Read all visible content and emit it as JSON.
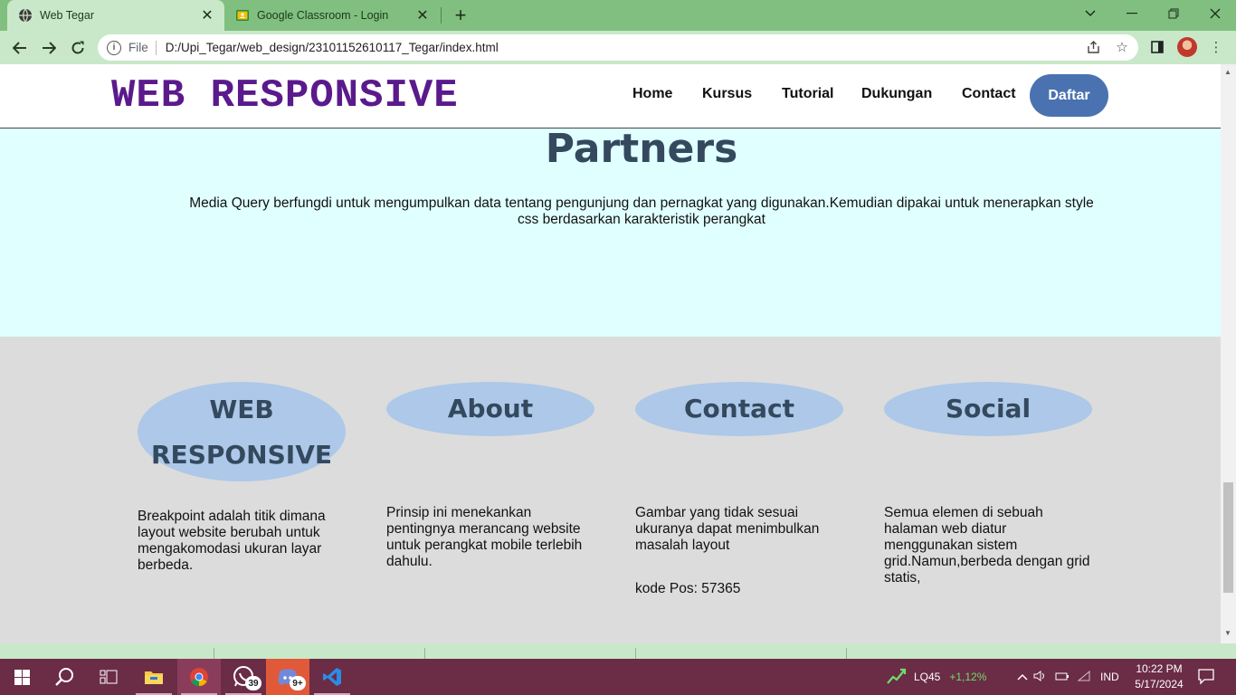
{
  "browser": {
    "tabs": [
      {
        "title": "Web Tegar",
        "active": true
      },
      {
        "title": "Google Classroom - Login",
        "active": false
      }
    ],
    "address": {
      "scheme_label": "File",
      "url": "D:/Upi_Tegar/web_design/23101152610117_Tegar/index.html"
    }
  },
  "site": {
    "logo": "WEB RESPONSIVE",
    "nav": [
      {
        "label": "Home"
      },
      {
        "label": "Kursus"
      },
      {
        "label": "Tutorial"
      },
      {
        "label": "Dukungan"
      },
      {
        "label": "Contact"
      }
    ],
    "cta_label": "Daftar"
  },
  "partners": {
    "title": "Partners",
    "text": "Media Query berfungdi untuk mengumpulkan data tentang pengunjung dan pernagkat yang digunakan.Kemudian dipakai untuk menerapkan style css berdasarkan karakteristik perangkat"
  },
  "footer": {
    "columns": [
      {
        "heading": "WEB RESPONSIVE",
        "text": "Breakpoint adalah titik dimana layout website berubah untuk mengakomodasi ukuran layar berbeda.",
        "extra": ""
      },
      {
        "heading": "About",
        "text": "Prinsip ini menekankan pentingnya merancang website untuk perangkat mobile terlebih dahulu.",
        "extra": ""
      },
      {
        "heading": "Contact",
        "text": "Gambar yang tidak sesuai ukuranya dapat menimbulkan masalah layout",
        "extra": "kode Pos: 57365"
      },
      {
        "heading": "Social",
        "text": "Semua elemen di sebuah halaman web diatur menggunakan sistem grid.Namun,berbeda dengan grid statis,",
        "extra": ""
      }
    ]
  },
  "taskbar": {
    "whatsapp_badge": "39",
    "discord_badge": "9+",
    "stock_name": "LQ45",
    "stock_change": "+1,12%",
    "language": "IND",
    "time": "10:22 PM",
    "date": "5/17/2024"
  },
  "colors": {
    "tabbar": "#80bf80",
    "toolbar": "#c9e8c9",
    "logo": "#5a1a8c",
    "cta": "#4a72b0",
    "partners_bg": "#e0ffff",
    "footer_bg": "#dcdcdc",
    "footer_heading_bg": "#adc8e8",
    "heading_text": "#34495e",
    "taskbar": "#6b2c45"
  }
}
